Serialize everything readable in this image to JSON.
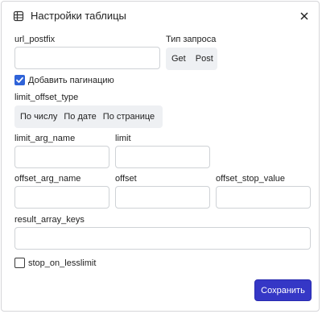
{
  "dialog": {
    "title": "Настройки таблицы",
    "title_icon": "table-icon",
    "close_icon": "close-icon"
  },
  "fields": {
    "url_postfix": {
      "label": "url_postfix",
      "value": ""
    },
    "request_type": {
      "label": "Тип запроса",
      "options": [
        "Get",
        "Post"
      ]
    },
    "pagination": {
      "label": "Добавить пагинацию",
      "checked": true
    },
    "limit_offset_type": {
      "label": "limit_offset_type",
      "options": [
        "По числу",
        "По дате",
        "По странице"
      ]
    },
    "limit_arg_name": {
      "label": "limit_arg_name",
      "value": ""
    },
    "limit": {
      "label": "limit",
      "value": ""
    },
    "offset_arg_name": {
      "label": "offset_arg_name",
      "value": ""
    },
    "offset": {
      "label": "offset",
      "value": ""
    },
    "offset_stop_value": {
      "label": "offset_stop_value",
      "value": ""
    },
    "result_array_keys": {
      "label": "result_array_keys",
      "value": ""
    },
    "stop_on_lesslimit": {
      "label": "stop_on_lesslimit",
      "checked": false
    }
  },
  "actions": {
    "save_label": "Сохранить"
  },
  "colors": {
    "accent": "#3537c6",
    "checkbox": "#2f63d8",
    "segment_bg": "#eef0f3",
    "border": "#cfd2d6"
  }
}
